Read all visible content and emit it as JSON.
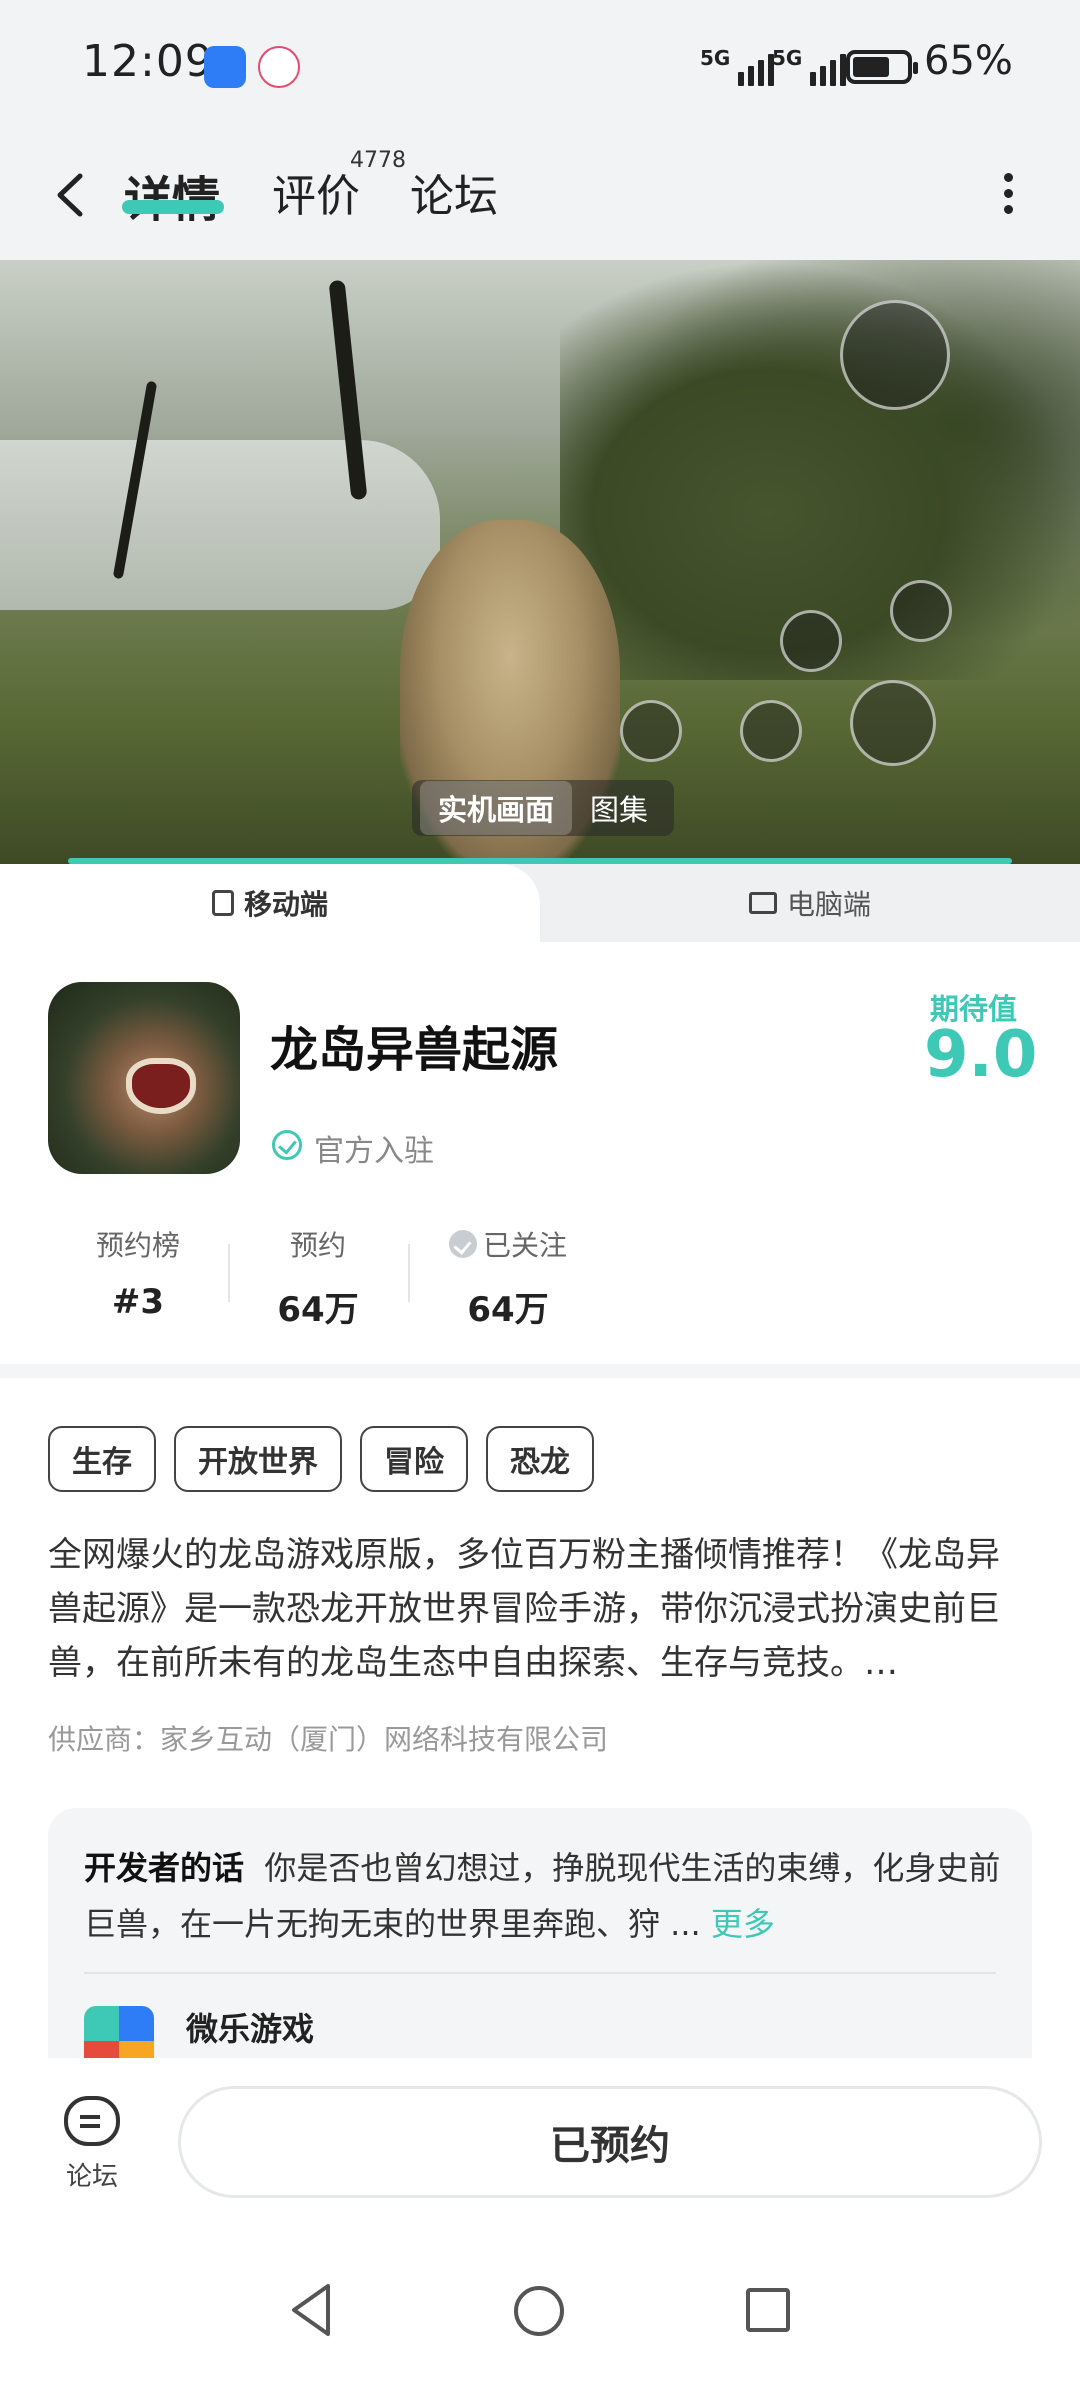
{
  "status_bar": {
    "time": "12:09",
    "signal_label_1": "5G",
    "signal_label_2": "5G",
    "battery": "65%"
  },
  "nav": {
    "tabs": [
      {
        "label": "详情",
        "active": true
      },
      {
        "label": "评价",
        "count": "4778"
      },
      {
        "label": "论坛"
      }
    ]
  },
  "hero": {
    "tabs": [
      "实机画面",
      "图集"
    ],
    "active_tab": "实机画面"
  },
  "platform": {
    "mobile": "移动端",
    "pc": "电脑端",
    "active": "移动端"
  },
  "game": {
    "title": "龙岛异兽起源",
    "verified": "官方入驻",
    "score_label": "期待值",
    "score": "9.0",
    "stats": [
      {
        "label": "预约榜",
        "value": "#3"
      },
      {
        "label": "预约",
        "value": "64万"
      },
      {
        "label": "已关注",
        "value": "64万"
      }
    ],
    "tags": [
      "生存",
      "开放世界",
      "冒险",
      "恐龙"
    ],
    "description": "全网爆火的龙岛游戏原版，多位百万粉主播倾情推荐！《龙岛异兽起源》是一款恐龙开放世界冒险手游，带你沉浸式扮演史前巨兽，在前所未有的龙岛生态中自由探索、生存与竞技。…",
    "supplier": "供应商：家乡互动（厦门）网络科技有限公司"
  },
  "developer": {
    "lead": "开发者的话",
    "text": "你是否也曾幻想过，挣脱现代生活的束缚，化身史前巨兽，在一片无拘无束的世界里奔跑、狩 ...",
    "more": "更多",
    "name": "微乐游戏"
  },
  "action_bar": {
    "forum_label": "论坛",
    "reserve_label": "已预约"
  },
  "colors": {
    "accent": "#3ec9b6"
  }
}
